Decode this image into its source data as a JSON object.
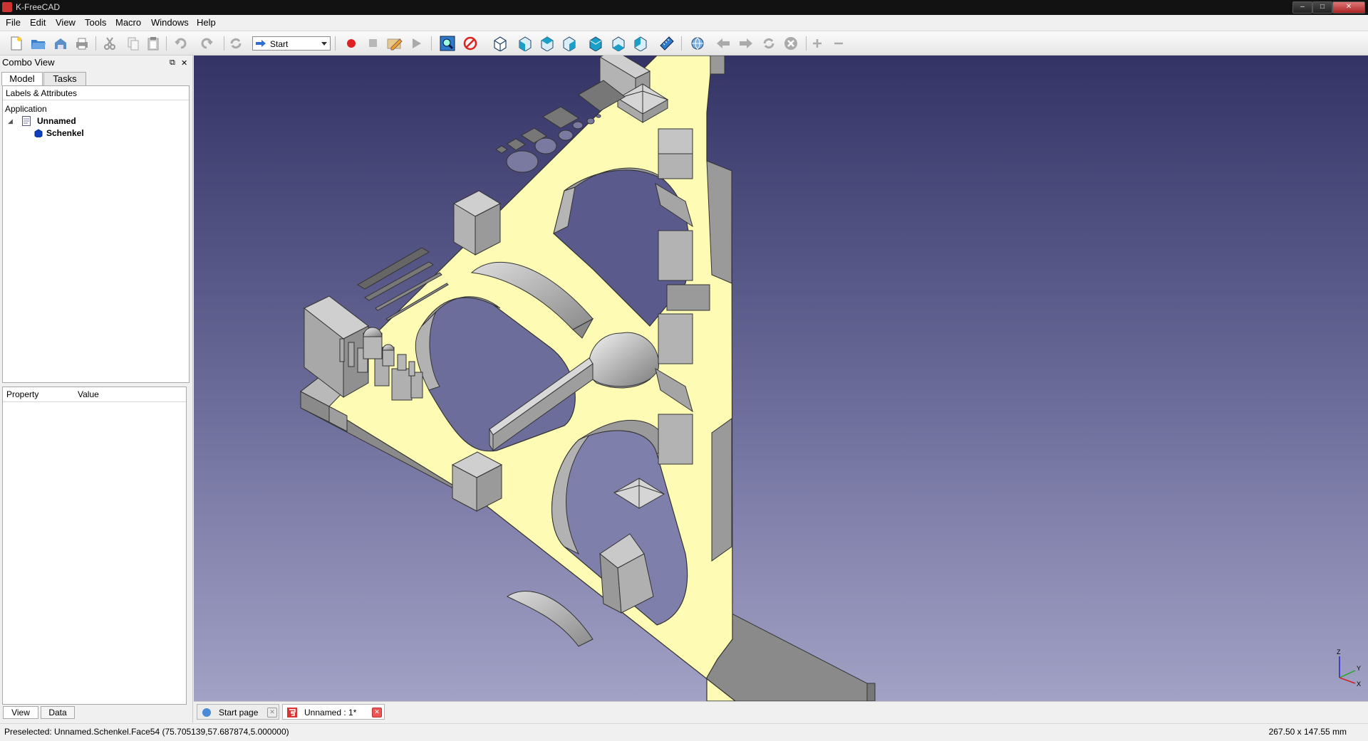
{
  "window": {
    "title": "K-FreeCAD"
  },
  "menu": [
    "File",
    "Edit",
    "View",
    "Tools",
    "Macro",
    "Windows",
    "Help"
  ],
  "toolbar": {
    "workbench": "Start"
  },
  "combo": {
    "title": "Combo View",
    "tabs": [
      "Model",
      "Tasks"
    ],
    "tree_header": "Labels & Attributes",
    "tree_root": "Application",
    "document": "Unnamed",
    "object": "Schenkel",
    "prop_columns": [
      "Property",
      "Value"
    ],
    "bottom_tabs": [
      "View",
      "Data"
    ]
  },
  "doc_tabs": [
    "Start page",
    "Unnamed : 1*"
  ],
  "status": {
    "preselected": "Preselected: Unnamed.Schenkel.Face54 (75.705139,57.687874,5.000000)",
    "dimensions": "267.50 x 147.55 mm"
  },
  "axis": {
    "z": "Z",
    "y": "Y",
    "x": "X"
  },
  "colors": {
    "model_face": "#fdfbb4",
    "model_side": "#8c8c8c",
    "background_top": "#333366",
    "background_bottom": "#a2a2c6"
  }
}
